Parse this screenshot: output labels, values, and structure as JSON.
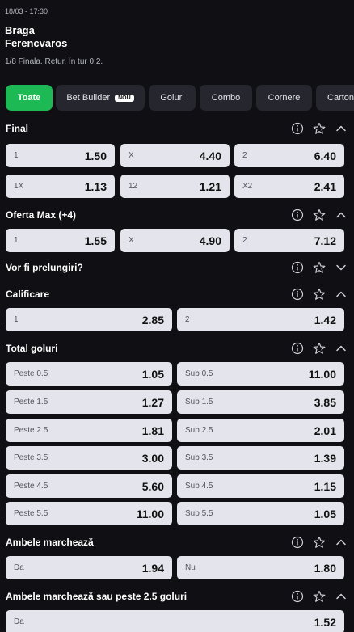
{
  "event": {
    "datetime": "18/03 - 17:30",
    "home": "Braga",
    "away": "Ferencvaros",
    "round": "1/8 Finala. Retur. În tur 0:2."
  },
  "filters": [
    {
      "label": "Toate",
      "active": true
    },
    {
      "label": "Bet Builder",
      "badge": "NOU"
    },
    {
      "label": "Goluri"
    },
    {
      "label": "Combo"
    },
    {
      "label": "Cornere"
    },
    {
      "label": "Cartonașe"
    }
  ],
  "icons": {
    "info": "info-icon",
    "favorite": "star-icon",
    "collapse": "chevron-up-icon",
    "expand": "chevron-down-icon"
  },
  "colors": {
    "accent": "#1db954",
    "background": "#0f0f14",
    "chip": "#26262e",
    "odd_button": "#e4e4ec"
  },
  "markets": {
    "final": {
      "title": "Final",
      "rows": [
        [
          {
            "label": "1",
            "odd": "1.50"
          },
          {
            "label": "X",
            "odd": "4.40"
          },
          {
            "label": "2",
            "odd": "6.40"
          }
        ],
        [
          {
            "label": "1X",
            "odd": "1.13"
          },
          {
            "label": "12",
            "odd": "1.21"
          },
          {
            "label": "X2",
            "odd": "2.41"
          }
        ]
      ]
    },
    "oferta_max": {
      "title": "Oferta Max (+4)",
      "rows": [
        [
          {
            "label": "1",
            "odd": "1.55"
          },
          {
            "label": "X",
            "odd": "4.90"
          },
          {
            "label": "2",
            "odd": "7.12"
          }
        ]
      ]
    },
    "prelungiri": {
      "title": "Vor fi prelungiri?"
    },
    "calificare": {
      "title": "Calificare",
      "rows": [
        [
          {
            "label": "1",
            "odd": "2.85"
          },
          {
            "label": "2",
            "odd": "1.42"
          }
        ]
      ]
    },
    "total_goluri": {
      "title": "Total goluri",
      "rows": [
        [
          {
            "label": "Peste 0.5",
            "odd": "1.05"
          },
          {
            "label": "Sub 0.5",
            "odd": "11.00"
          }
        ],
        [
          {
            "label": "Peste 1.5",
            "odd": "1.27"
          },
          {
            "label": "Sub 1.5",
            "odd": "3.85"
          }
        ],
        [
          {
            "label": "Peste 2.5",
            "odd": "1.81"
          },
          {
            "label": "Sub 2.5",
            "odd": "2.01"
          }
        ],
        [
          {
            "label": "Peste 3.5",
            "odd": "3.00"
          },
          {
            "label": "Sub 3.5",
            "odd": "1.39"
          }
        ],
        [
          {
            "label": "Peste 4.5",
            "odd": "5.60"
          },
          {
            "label": "Sub 4.5",
            "odd": "1.15"
          }
        ],
        [
          {
            "label": "Peste 5.5",
            "odd": "11.00"
          },
          {
            "label": "Sub 5.5",
            "odd": "1.05"
          }
        ]
      ]
    },
    "ambele": {
      "title": "Ambele marchează",
      "rows": [
        [
          {
            "label": "Da",
            "odd": "1.94"
          },
          {
            "label": "Nu",
            "odd": "1.80"
          }
        ]
      ]
    },
    "ambele_peste": {
      "title": "Ambele marchează sau peste 2.5 goluri",
      "rows": [
        [
          {
            "label": "Da",
            "odd": "1.52"
          }
        ]
      ]
    }
  }
}
